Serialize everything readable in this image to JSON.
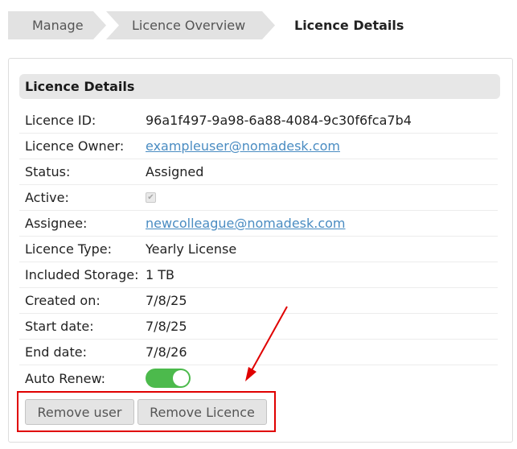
{
  "breadcrumb": {
    "items": [
      "Manage",
      "Licence Overview",
      "Licence Details"
    ]
  },
  "section": {
    "title": "Licence Details"
  },
  "details": {
    "licence_id": {
      "label": "Licence ID:",
      "value": "96a1f497-9a98-6a88-4084-9c30f6fca7b4"
    },
    "licence_owner": {
      "label": "Licence Owner:",
      "value": "exampleuser@nomadesk.com"
    },
    "status": {
      "label": "Status:",
      "value": "Assigned"
    },
    "active": {
      "label": "Active:",
      "checked": true
    },
    "assignee": {
      "label": "Assignee:",
      "value": "newcolleague@nomadesk.com"
    },
    "licence_type": {
      "label": "Licence Type:",
      "value": "Yearly License"
    },
    "included_storage": {
      "label": "Included Storage:",
      "value": "1 TB"
    },
    "created_on": {
      "label": "Created on:",
      "value": "7/8/25"
    },
    "start_date": {
      "label": "Start date:",
      "value": "7/8/25"
    },
    "end_date": {
      "label": "End date:",
      "value": "7/8/26"
    },
    "auto_renew": {
      "label": "Auto Renew:",
      "enabled": true
    }
  },
  "actions": {
    "remove_user": "Remove user",
    "remove_licence": "Remove Licence"
  },
  "colors": {
    "link": "#4a8cc2",
    "toggle_on": "#4cba4c",
    "annotation": "#e00000",
    "breadcrumb_bg": "#e2e2e2",
    "header_bg": "#e7e7e7"
  },
  "icons": {
    "checkbox": "checkmark-icon",
    "annotation_arrow": "arrow-icon"
  }
}
